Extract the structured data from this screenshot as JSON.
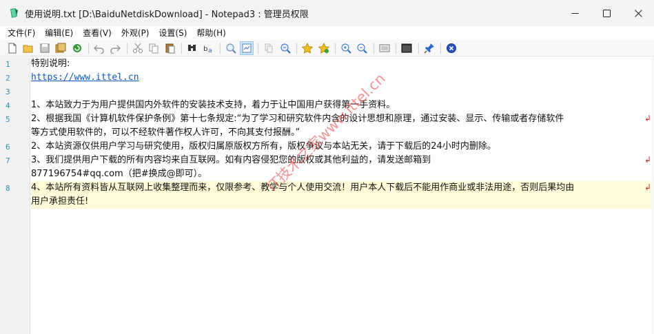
{
  "window": {
    "title": "使用说明.txt [D:\\BaiduNetdiskDownload] - Notepad3 : 管理员权限",
    "app_icon": "notepad3-icon",
    "controls": [
      "minimize-icon",
      "maximize-icon",
      "close-icon"
    ]
  },
  "menu": [
    {
      "label": "文件(F)"
    },
    {
      "label": "编辑(E)"
    },
    {
      "label": "查看(V)"
    },
    {
      "label": "外观(P)"
    },
    {
      "label": "设置(S)"
    },
    {
      "label": "帮助(H)"
    }
  ],
  "toolbar": {
    "icons": [
      "new-file-icon",
      "open-folder-icon",
      "save-icon",
      "save-as-icon",
      "refresh-icon",
      "undo-icon",
      "redo-icon",
      "cut-icon",
      "copy-icon",
      "paste-icon",
      "find-icon",
      "replace-icon",
      "zoom-fit-icon",
      "word-wrap-icon",
      "copy-format-icon",
      "find-in-files-icon",
      "favorite-star-icon",
      "add-favorite-icon",
      "zoom-in-icon",
      "zoom-out-icon",
      "scheme-icon",
      "terminal-icon",
      "pin-icon",
      "exit-icon"
    ]
  },
  "editor": {
    "line_numbers": [
      "1",
      "2",
      "3",
      "4",
      "5",
      "6",
      "7",
      "8"
    ],
    "lines": [
      "特别说明:",
      "https://www.ittel.cn",
      "",
      "1、本站致力于为用户提供国内外软件的安装技术支持，着力于让中国用户获得第一手资料。",
      "2、根据我国《计算机软件保护条例》第十七条规定:“为了学习和研究软件内含的设计思想和原理，通过安装、显示、传输或者存储软件",
      "等方式使用软件的，可以不经软件著作权人许可，不向其支付报酬。”",
      "2、本站资源仅供用户学习与研究使用，版权归属原版权方所有，版权争议与本站无关，请于下载后的24小时内删除。",
      "3、我们提供用户下载的所有内容均来自互联网。如有内容侵犯您的版权或其他利益的，请发送邮箱到",
      "877196754#qq.com（把#换成@即可）。",
      "4、本站所有资料皆从互联网上收集整理而来，仅限参考、教学与个人使用交流！用户本人下载后不能用作商业或非法用途，否则后果均由",
      "用户承担责任!"
    ],
    "wrap_symbol": "↲",
    "watermark": "IT技术之家www.ittel.cn"
  },
  "colors": {
    "titlebar": "#f3f3f3",
    "gutter": "#f2f2f2",
    "line_number": "#2b91af",
    "current_line": "#fffbd8",
    "link": "#0b57b8",
    "watermark": "#eb3c3c"
  }
}
